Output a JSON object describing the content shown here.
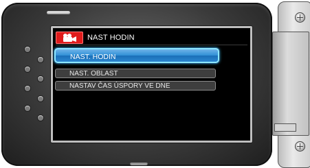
{
  "menu": {
    "title": "NAST HODIN",
    "title_icon": "video-camera-icon",
    "items": [
      {
        "label": "NAST. HODIN",
        "selected": true
      },
      {
        "label": "NAST. OBLAST",
        "selected": false
      },
      {
        "label": "NASTAV ČAS ÚSPORY VE DNE",
        "selected": false
      }
    ]
  },
  "colors": {
    "accent_red": "#e01b1b",
    "selection_blue": "#2f8fd6",
    "selection_glow": "#8fe8ff"
  }
}
